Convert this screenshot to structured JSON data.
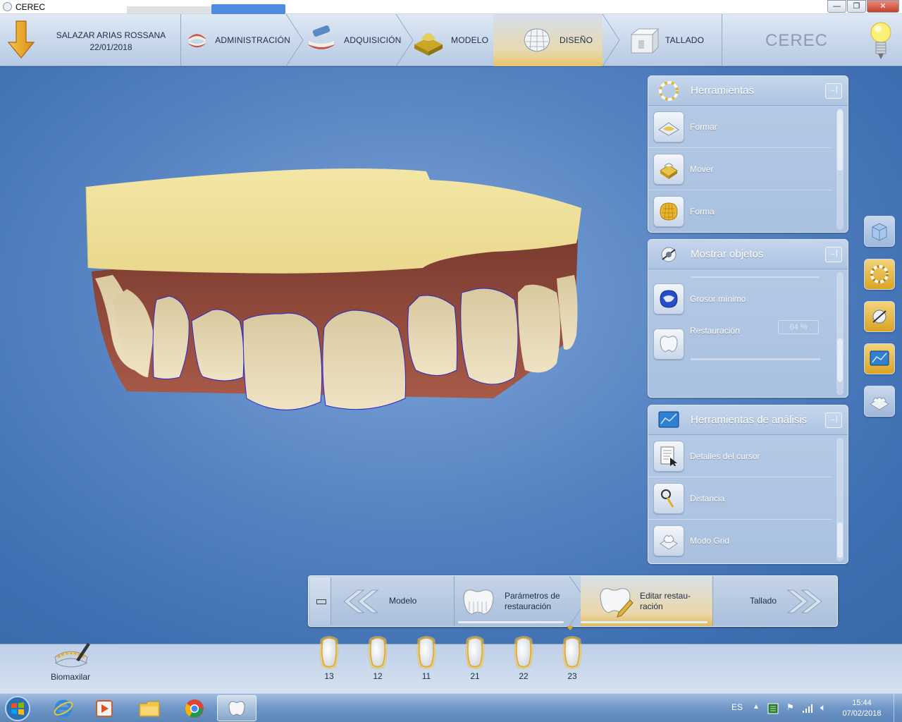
{
  "window": {
    "title": "CEREC",
    "controls": [
      "minimize",
      "maximize",
      "close"
    ]
  },
  "patient": {
    "name": "SALAZAR ARIAS ROSSANA",
    "date": "22/01/2018"
  },
  "phases": [
    {
      "label": "ADMINISTRACIÓN",
      "icon": "denture-icon",
      "active": false
    },
    {
      "label": "ADQUISICIÓN",
      "icon": "scan-denture-icon",
      "active": false
    },
    {
      "label": "MODELO",
      "icon": "model-icon",
      "active": false
    },
    {
      "label": "DISEÑO",
      "icon": "design-mesh-icon",
      "active": true
    },
    {
      "label": "TALLADO",
      "icon": "milling-icon",
      "active": false
    }
  ],
  "brand": "CEREC",
  "panels": {
    "herramientas": {
      "title": "Herramientas",
      "items": [
        {
          "label": "Formar",
          "icon": "shape-icon"
        },
        {
          "label": "Mover",
          "icon": "move-icon"
        },
        {
          "label": "Forma",
          "icon": "form-icon"
        }
      ]
    },
    "mostrar_objetos": {
      "title": "Mostrar objetos",
      "items": [
        {
          "label": "Grosor mínimo",
          "icon": "min-thickness-icon"
        },
        {
          "label": "Restauración",
          "icon": "restoration-icon",
          "value": "64 %"
        }
      ]
    },
    "analisis": {
      "title": "Herramientas de análisis",
      "items": [
        {
          "label": "Detalles del cursor",
          "icon": "cursor-details-icon"
        },
        {
          "label": "Distancia",
          "icon": "distance-icon"
        },
        {
          "label": "Modo Grid",
          "icon": "grid-mode-icon"
        }
      ]
    }
  },
  "workflow": {
    "back_label": "Modelo",
    "params_label_1": "Parámetros de",
    "params_label_2": "restauración",
    "edit_label_1": "Editar restau-",
    "edit_label_2": "ración",
    "next_label": "Tallado"
  },
  "teeth": [
    "13",
    "12",
    "11",
    "21",
    "22",
    "23"
  ],
  "biomaxilar_label": "Biomaxilar",
  "taskbar": {
    "language": "ES",
    "time": "15:44",
    "date": "07/02/2018"
  }
}
